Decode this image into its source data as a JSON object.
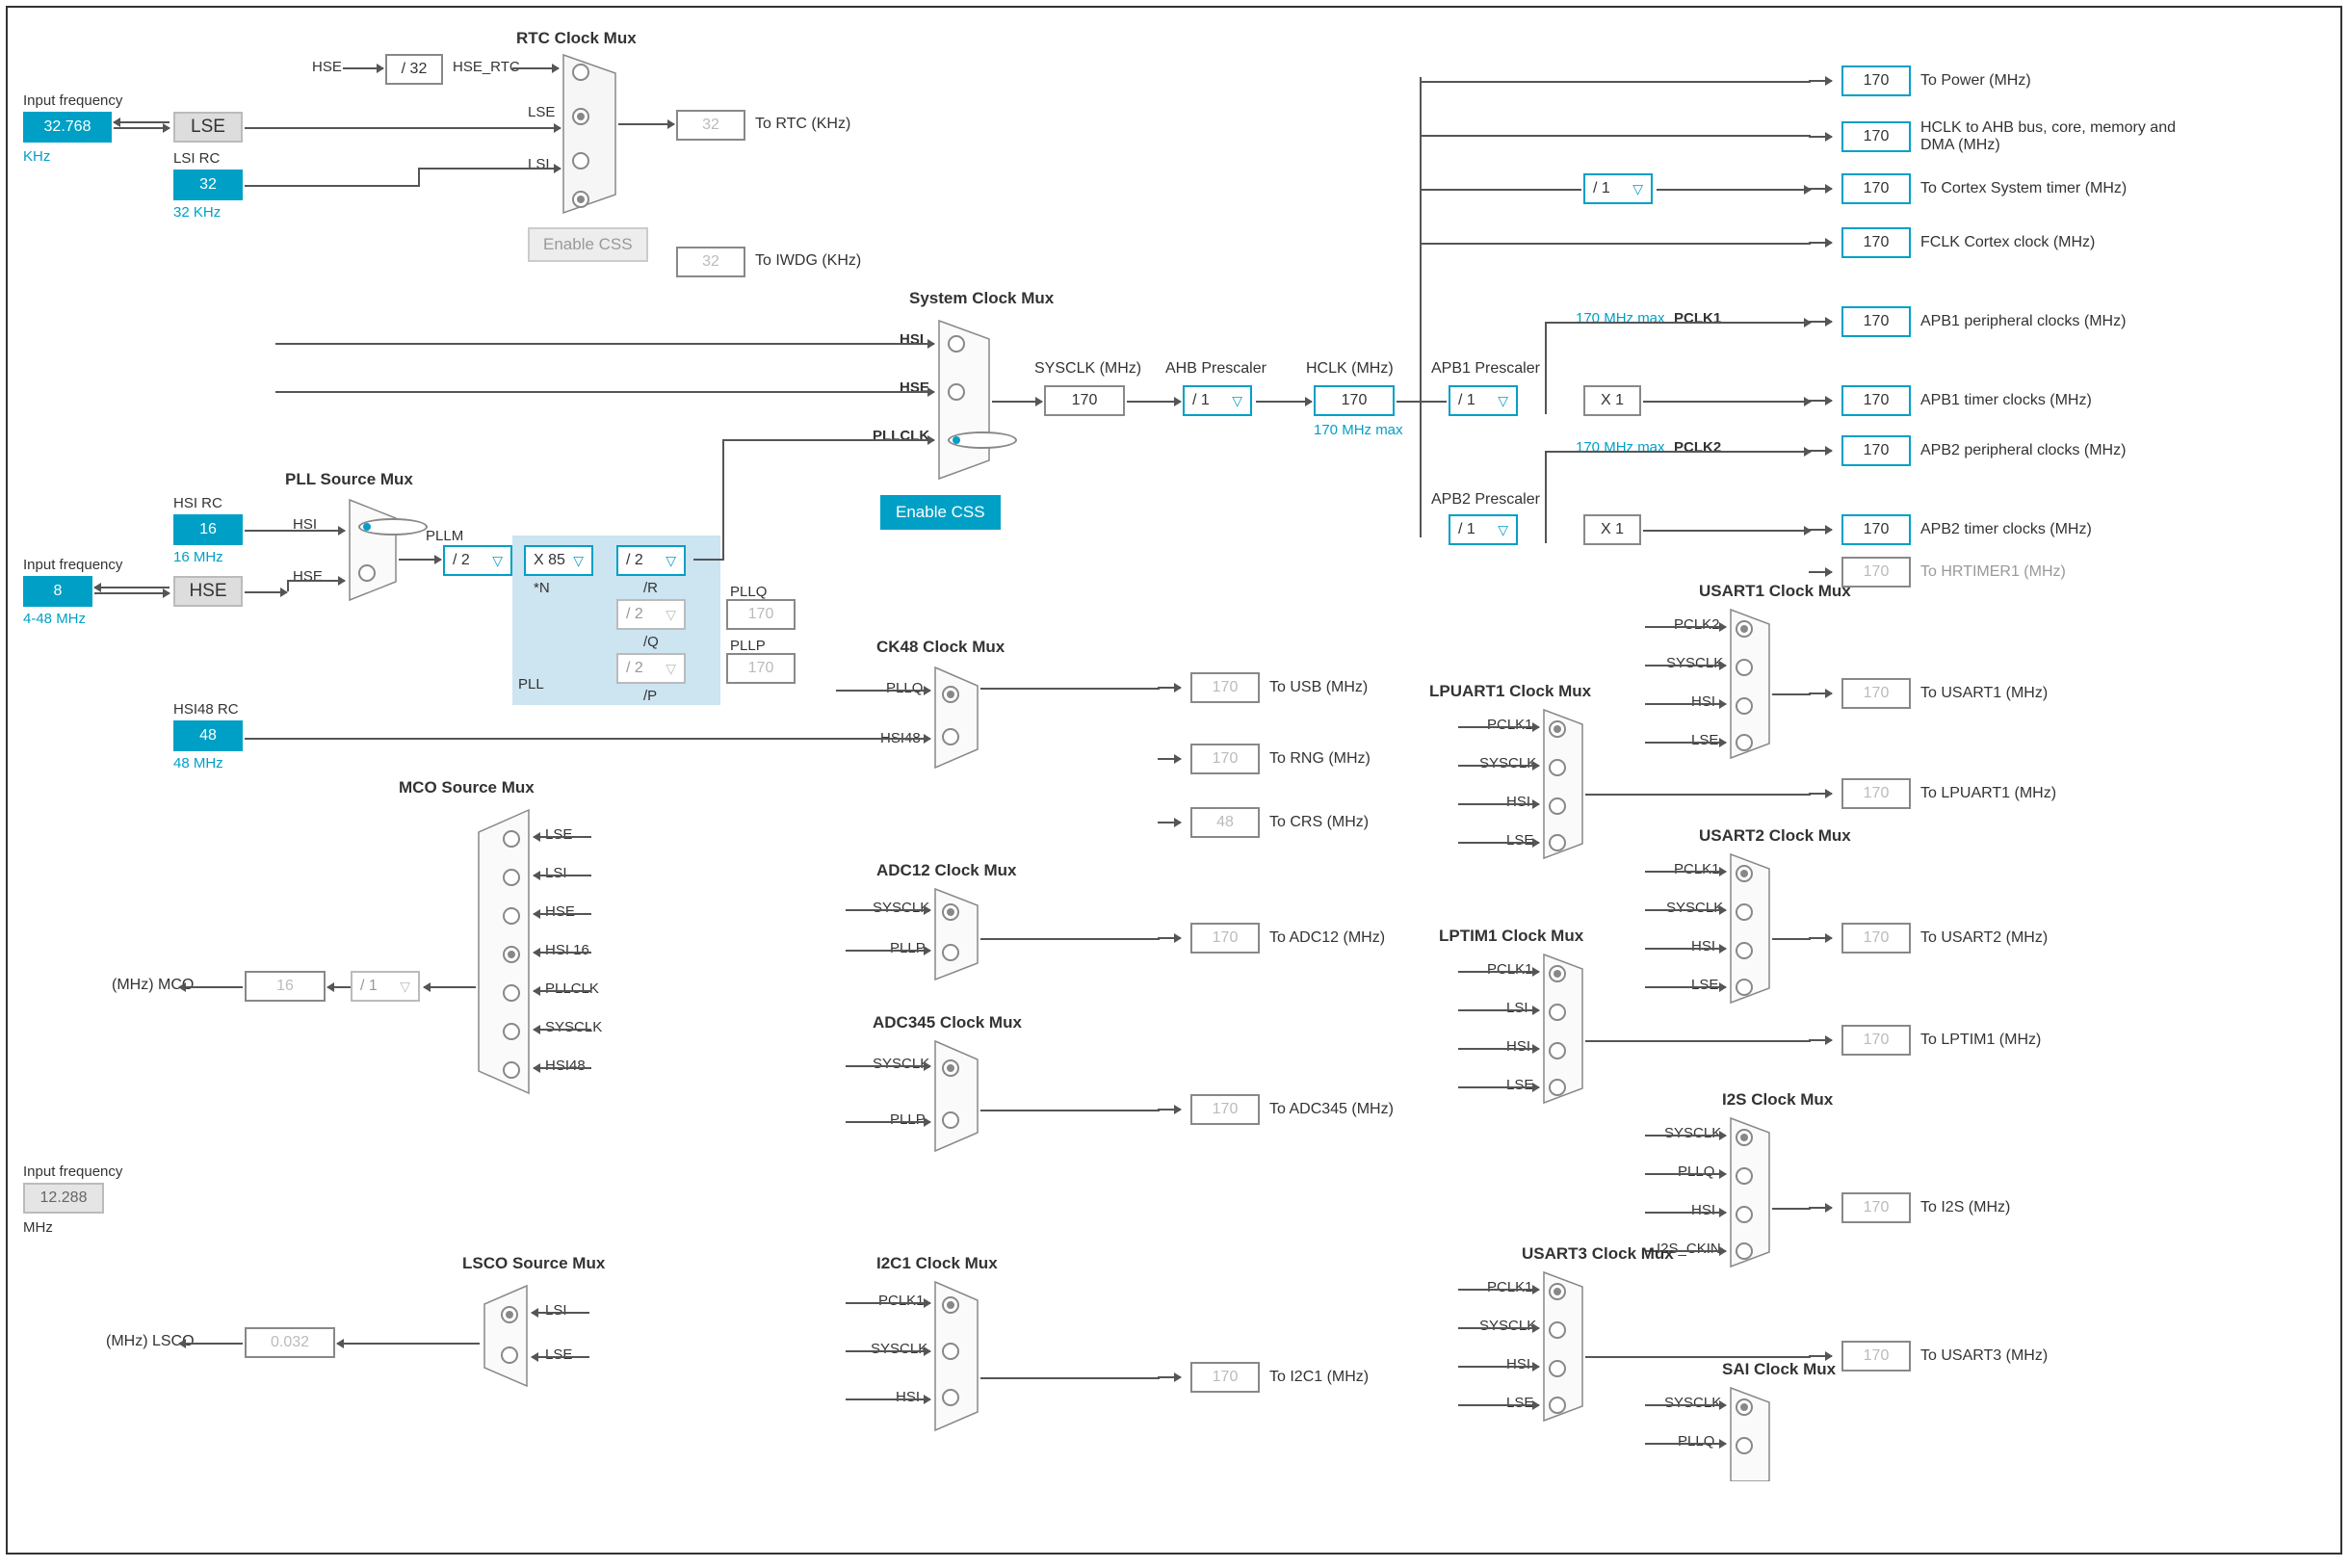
{
  "inputs": {
    "lse": {
      "label": "Input frequency",
      "value": "32.768",
      "unit": "KHz",
      "block": "LSE"
    },
    "lsi": {
      "label": "LSI RC",
      "value": "32",
      "unit": "32 KHz"
    },
    "hsi": {
      "label": "HSI RC",
      "value": "16",
      "unit": "16 MHz"
    },
    "hse": {
      "label": "Input frequency",
      "value": "8",
      "unit": "4-48 MHz",
      "block": "HSE"
    },
    "hsi48": {
      "label": "HSI48 RC",
      "value": "48",
      "unit": "48 MHz"
    },
    "i2s_ckin": {
      "label": "Input frequency",
      "value": "12.288",
      "unit": "MHz"
    }
  },
  "rtc": {
    "title": "RTC Clock Mux",
    "div": "/ 32",
    "hse_line": "HSE",
    "hse_rtc": "HSE_RTC",
    "lse_in": "LSE",
    "lsi_in": "LSI",
    "out_val": "32",
    "out_label": "To RTC (KHz)",
    "css": "Enable CSS",
    "iwdg_val": "32",
    "iwdg_label": "To IWDG (KHz)"
  },
  "pll_src": {
    "title": "PLL Source Mux",
    "hsi": "HSI",
    "hse": "HSE"
  },
  "pll": {
    "pllm": "PLLM",
    "pllm_val": "/ 2",
    "n_label": "*N",
    "n_val": "X 85",
    "r_div": "/ 2",
    "r_lbl": "/R",
    "q_div": "/ 2",
    "q_lbl": "/Q",
    "q_out": "PLLQ",
    "q_val": "170",
    "p_div": "/ 2",
    "p_lbl": "/P",
    "p_out": "PLLP",
    "p_val": "170",
    "region": "PLL"
  },
  "sysclk": {
    "title": "System Clock Mux",
    "hsi": "HSI",
    "hse": "HSE",
    "pllclk": "PLLCLK",
    "css": "Enable CSS",
    "out_label": "SYSCLK (MHz)",
    "out_val": "170"
  },
  "ahb": {
    "label": "AHB Prescaler",
    "val": "/ 1",
    "hclk_label": "HCLK (MHz)",
    "hclk_val": "170",
    "hclk_max": "170 MHz max"
  },
  "cortex_div": "/ 1",
  "apb1": {
    "label": "APB1 Prescaler",
    "val": "/ 1",
    "mult": "X 1",
    "max": "170 MHz max",
    "pclk": "PCLK1"
  },
  "apb2": {
    "label": "APB2 Prescaler",
    "val": "/ 1",
    "mult": "X 1",
    "max": "170 MHz max",
    "pclk": "PCLK2"
  },
  "outputs_right": [
    {
      "val": "170",
      "label": "To Power (MHz)",
      "teal": true
    },
    {
      "val": "170",
      "label": "HCLK to AHB bus, core, memory and DMA (MHz)",
      "teal": true
    },
    {
      "val": "170",
      "label": "To Cortex System timer (MHz)",
      "teal": true
    },
    {
      "val": "170",
      "label": "FCLK Cortex clock (MHz)",
      "teal": true
    },
    {
      "val": "170",
      "label": "APB1 peripheral clocks (MHz)",
      "teal": true
    },
    {
      "val": "170",
      "label": "APB1 timer clocks (MHz)",
      "teal": true
    },
    {
      "val": "170",
      "label": "APB2 peripheral clocks (MHz)",
      "teal": true
    },
    {
      "val": "170",
      "label": "APB2 timer clocks (MHz)",
      "teal": true
    },
    {
      "val": "170",
      "label": "To HRTIMER1 (MHz)",
      "teal": false
    }
  ],
  "ck48": {
    "title": "CK48 Clock Mux",
    "in": [
      "PLLQ",
      "HSI48"
    ],
    "usb_val": "170",
    "usb_label": "To USB (MHz)",
    "rng_val": "170",
    "rng_label": "To RNG (MHz)",
    "crs_val": "48",
    "crs_label": "To CRS (MHz)"
  },
  "adc12": {
    "title": "ADC12 Clock Mux",
    "in": [
      "SYSCLK",
      "PLLP"
    ],
    "val": "170",
    "label": "To ADC12 (MHz)"
  },
  "adc345": {
    "title": "ADC345 Clock Mux",
    "in": [
      "SYSCLK",
      "PLLP"
    ],
    "val": "170",
    "label": "To ADC345 (MHz)"
  },
  "i2c1": {
    "title": "I2C1 Clock Mux",
    "in": [
      "PCLK1",
      "SYSCLK",
      "HSI"
    ],
    "val": "170",
    "label": "To I2C1 (MHz)"
  },
  "mco": {
    "title": "MCO Source Mux",
    "in": [
      "LSE",
      "LSI",
      "HSE",
      "HSI 16",
      "PLLCLK",
      "SYSCLK",
      "HSI48"
    ],
    "div": "/ 1",
    "val": "16",
    "label": "(MHz) MCO"
  },
  "lsco": {
    "title": "LSCO Source Mux",
    "in": [
      "LSI",
      "LSE"
    ],
    "val": "0.032",
    "label": "(MHz) LSCO"
  },
  "usart1": {
    "title": "USART1 Clock Mux",
    "in": [
      "PCLK2",
      "SYSCLK",
      "HSI",
      "LSE"
    ],
    "val": "170",
    "label": "To USART1 (MHz)"
  },
  "usart2": {
    "title": "USART2 Clock Mux",
    "in": [
      "PCLK1",
      "SYSCLK",
      "HSI",
      "LSE"
    ],
    "val": "170",
    "label": "To USART2 (MHz)"
  },
  "usart3": {
    "title": "USART3 Clock Mux",
    "in": [
      "PCLK1",
      "SYSCLK",
      "HSI",
      "LSE"
    ],
    "val": "170",
    "label": "To USART3 (MHz)"
  },
  "lpuart1": {
    "title": "LPUART1 Clock Mux",
    "in": [
      "PCLK1",
      "SYSCLK",
      "HSI",
      "LSE"
    ],
    "val": "170",
    "label": "To LPUART1 (MHz)"
  },
  "lptim1": {
    "title": "LPTIM1 Clock Mux",
    "in": [
      "PCLK1",
      "LSI",
      "HSI",
      "LSE"
    ],
    "val": "170",
    "label": "To LPTIM1 (MHz)"
  },
  "i2s": {
    "title": "I2S Clock Mux",
    "in": [
      "SYSCLK",
      "PLLQ",
      "HSI",
      "I2S_CKIN"
    ],
    "val": "170",
    "label": "To I2S (MHz)"
  },
  "sai": {
    "title": "SAI Clock Mux",
    "in": [
      "SYSCLK",
      "PLLQ"
    ]
  }
}
